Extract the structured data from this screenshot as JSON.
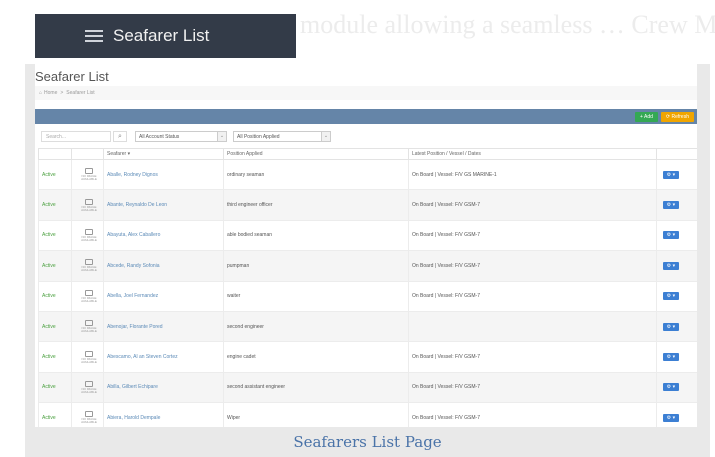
{
  "background_text": "module allowing a seamless …  Crew Management",
  "header": {
    "title": "Seafarer List"
  },
  "page": {
    "title": "Seafarer List"
  },
  "breadcrumb": {
    "home": "Home",
    "separator": ">",
    "current": "Seafarer List"
  },
  "toolbar": {
    "add_label": "Add",
    "refresh_label": "Refresh"
  },
  "filters": {
    "search_placeholder": "Search...",
    "account_status": "All Account Status",
    "position": "All Position Applied"
  },
  "table": {
    "columns": [
      "",
      "",
      "Seafarer ▾",
      "Position Applied",
      "Latest Position / Vessel / Dates",
      ""
    ],
    "rows": [
      {
        "status": "Active",
        "no_image": "NO IMAGE AVAILABLE",
        "name": "Aballe, Rodney Dignos",
        "position": "ordinary seaman",
        "latest": "On Board | Vessel: F/V GS MARINE-1"
      },
      {
        "status": "Active",
        "no_image": "NO IMAGE AVAILABLE",
        "name": "Abante, Reynaldo De Leon",
        "position": "third engineer officer",
        "latest": "On Board | Vessel: F/V GSM-7"
      },
      {
        "status": "Active",
        "no_image": "NO IMAGE AVAILABLE",
        "name": "Abayuta, Alex Caballero",
        "position": "able bodied seaman",
        "latest": "On Board | Vessel: F/V GSM-7"
      },
      {
        "status": "Active",
        "no_image": "NO IMAGE AVAILABLE",
        "name": "Abcede, Randy Sofonia",
        "position": "pumpman",
        "latest": "On Board | Vessel: F/V GSM-7"
      },
      {
        "status": "Active",
        "no_image": "NO IMAGE AVAILABLE",
        "name": "Abella, Joel Fernandez",
        "position": "waiter",
        "latest": "On Board | Vessel: F/V GSM-7"
      },
      {
        "status": "Active",
        "no_image": "NO IMAGE AVAILABLE",
        "name": "Abenojar, Florante Pored",
        "position": "second engineer",
        "latest": ""
      },
      {
        "status": "Active",
        "no_image": "NO IMAGE AVAILABLE",
        "name": "Abescamo, Al an Steven Cortez",
        "position": "engine cadet",
        "latest": "On Board | Vessel: F/V GSM-7"
      },
      {
        "status": "Active",
        "no_image": "NO IMAGE AVAILABLE",
        "name": "Abilla, Gilbert Echipare",
        "position": "second assistant engineer",
        "latest": "On Board | Vessel: F/V GSM-7"
      },
      {
        "status": "Active",
        "no_image": "NO IMAGE AVAILABLE",
        "name": "Abiera, Harold Dempale",
        "position": "Wiper",
        "latest": "On Board | Vessel: F/V GSM-7"
      }
    ]
  },
  "caption": "Seafarers List Page",
  "colors": {
    "header_bg": "#333b48",
    "toolbar": "#6585a8",
    "add": "#34a853",
    "refresh": "#f0a500",
    "status": "#4aa03f",
    "link": "#5b8ab7",
    "action": "#3c7fd3",
    "caption": "#4a73a8"
  }
}
